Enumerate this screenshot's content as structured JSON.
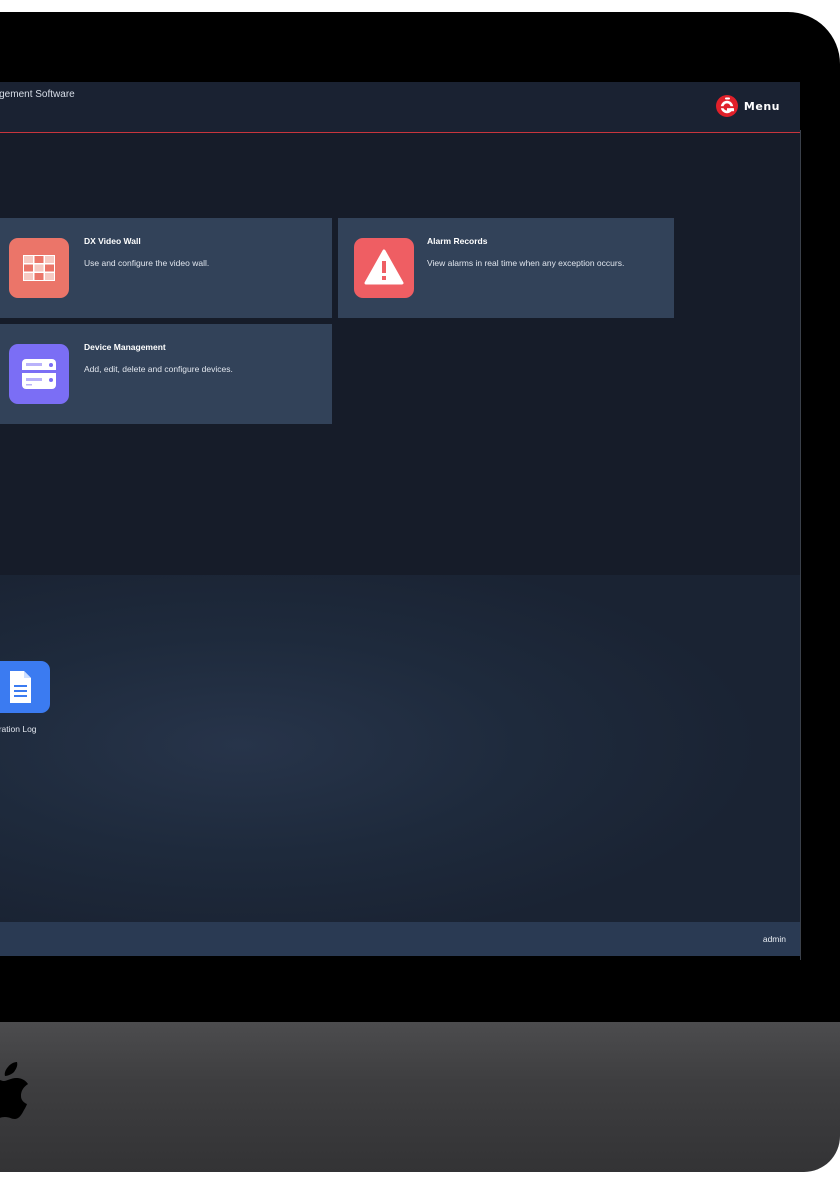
{
  "app": {
    "title": "nagement Software",
    "menu_label": "Menu"
  },
  "modules": [
    {
      "title": "DX Video Wall",
      "description": "Use and configure the video wall.",
      "icon": "video-wall-icon",
      "color": "#eb7569"
    },
    {
      "title": "Alarm Records",
      "description": "View alarms in real time when any exception occurs.",
      "icon": "warning-icon",
      "color": "#ef5e63"
    },
    {
      "title": "Device Management",
      "description": "Add, edit, delete and configure devices.",
      "icon": "server-icon",
      "color": "#7b6ef5"
    }
  ],
  "tools": [
    {
      "label": "eration Log",
      "icon": "document-icon",
      "color": "#3b7bf1"
    }
  ],
  "status": {
    "user": "admin"
  },
  "colors": {
    "accent_line": "#c8353d",
    "background": "#161c29",
    "card": "#324259",
    "statusbar": "#2a3a53"
  }
}
